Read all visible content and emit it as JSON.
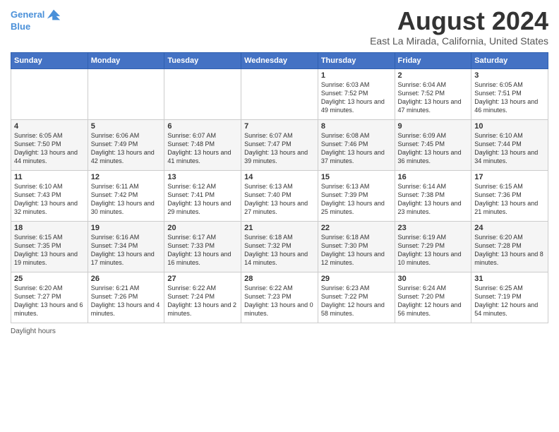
{
  "header": {
    "logo_line1": "General",
    "logo_line2": "Blue",
    "main_title": "August 2024",
    "subtitle": "East La Mirada, California, United States"
  },
  "calendar": {
    "days_of_week": [
      "Sunday",
      "Monday",
      "Tuesday",
      "Wednesday",
      "Thursday",
      "Friday",
      "Saturday"
    ],
    "weeks": [
      [
        {
          "day": "",
          "info": ""
        },
        {
          "day": "",
          "info": ""
        },
        {
          "day": "",
          "info": ""
        },
        {
          "day": "",
          "info": ""
        },
        {
          "day": "1",
          "info": "Sunrise: 6:03 AM\nSunset: 7:52 PM\nDaylight: 13 hours and 49 minutes."
        },
        {
          "day": "2",
          "info": "Sunrise: 6:04 AM\nSunset: 7:52 PM\nDaylight: 13 hours and 47 minutes."
        },
        {
          "day": "3",
          "info": "Sunrise: 6:05 AM\nSunset: 7:51 PM\nDaylight: 13 hours and 46 minutes."
        }
      ],
      [
        {
          "day": "4",
          "info": "Sunrise: 6:05 AM\nSunset: 7:50 PM\nDaylight: 13 hours and 44 minutes."
        },
        {
          "day": "5",
          "info": "Sunrise: 6:06 AM\nSunset: 7:49 PM\nDaylight: 13 hours and 42 minutes."
        },
        {
          "day": "6",
          "info": "Sunrise: 6:07 AM\nSunset: 7:48 PM\nDaylight: 13 hours and 41 minutes."
        },
        {
          "day": "7",
          "info": "Sunrise: 6:07 AM\nSunset: 7:47 PM\nDaylight: 13 hours and 39 minutes."
        },
        {
          "day": "8",
          "info": "Sunrise: 6:08 AM\nSunset: 7:46 PM\nDaylight: 13 hours and 37 minutes."
        },
        {
          "day": "9",
          "info": "Sunrise: 6:09 AM\nSunset: 7:45 PM\nDaylight: 13 hours and 36 minutes."
        },
        {
          "day": "10",
          "info": "Sunrise: 6:10 AM\nSunset: 7:44 PM\nDaylight: 13 hours and 34 minutes."
        }
      ],
      [
        {
          "day": "11",
          "info": "Sunrise: 6:10 AM\nSunset: 7:43 PM\nDaylight: 13 hours and 32 minutes."
        },
        {
          "day": "12",
          "info": "Sunrise: 6:11 AM\nSunset: 7:42 PM\nDaylight: 13 hours and 30 minutes."
        },
        {
          "day": "13",
          "info": "Sunrise: 6:12 AM\nSunset: 7:41 PM\nDaylight: 13 hours and 29 minutes."
        },
        {
          "day": "14",
          "info": "Sunrise: 6:13 AM\nSunset: 7:40 PM\nDaylight: 13 hours and 27 minutes."
        },
        {
          "day": "15",
          "info": "Sunrise: 6:13 AM\nSunset: 7:39 PM\nDaylight: 13 hours and 25 minutes."
        },
        {
          "day": "16",
          "info": "Sunrise: 6:14 AM\nSunset: 7:38 PM\nDaylight: 13 hours and 23 minutes."
        },
        {
          "day": "17",
          "info": "Sunrise: 6:15 AM\nSunset: 7:36 PM\nDaylight: 13 hours and 21 minutes."
        }
      ],
      [
        {
          "day": "18",
          "info": "Sunrise: 6:15 AM\nSunset: 7:35 PM\nDaylight: 13 hours and 19 minutes."
        },
        {
          "day": "19",
          "info": "Sunrise: 6:16 AM\nSunset: 7:34 PM\nDaylight: 13 hours and 17 minutes."
        },
        {
          "day": "20",
          "info": "Sunrise: 6:17 AM\nSunset: 7:33 PM\nDaylight: 13 hours and 16 minutes."
        },
        {
          "day": "21",
          "info": "Sunrise: 6:18 AM\nSunset: 7:32 PM\nDaylight: 13 hours and 14 minutes."
        },
        {
          "day": "22",
          "info": "Sunrise: 6:18 AM\nSunset: 7:30 PM\nDaylight: 13 hours and 12 minutes."
        },
        {
          "day": "23",
          "info": "Sunrise: 6:19 AM\nSunset: 7:29 PM\nDaylight: 13 hours and 10 minutes."
        },
        {
          "day": "24",
          "info": "Sunrise: 6:20 AM\nSunset: 7:28 PM\nDaylight: 13 hours and 8 minutes."
        }
      ],
      [
        {
          "day": "25",
          "info": "Sunrise: 6:20 AM\nSunset: 7:27 PM\nDaylight: 13 hours and 6 minutes."
        },
        {
          "day": "26",
          "info": "Sunrise: 6:21 AM\nSunset: 7:26 PM\nDaylight: 13 hours and 4 minutes."
        },
        {
          "day": "27",
          "info": "Sunrise: 6:22 AM\nSunset: 7:24 PM\nDaylight: 13 hours and 2 minutes."
        },
        {
          "day": "28",
          "info": "Sunrise: 6:22 AM\nSunset: 7:23 PM\nDaylight: 13 hours and 0 minutes."
        },
        {
          "day": "29",
          "info": "Sunrise: 6:23 AM\nSunset: 7:22 PM\nDaylight: 12 hours and 58 minutes."
        },
        {
          "day": "30",
          "info": "Sunrise: 6:24 AM\nSunset: 7:20 PM\nDaylight: 12 hours and 56 minutes."
        },
        {
          "day": "31",
          "info": "Sunrise: 6:25 AM\nSunset: 7:19 PM\nDaylight: 12 hours and 54 minutes."
        }
      ]
    ]
  },
  "footer": {
    "daylight_label": "Daylight hours"
  }
}
